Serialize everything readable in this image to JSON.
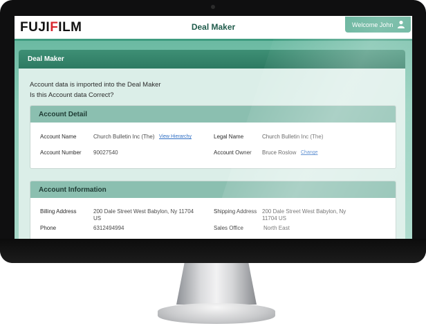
{
  "header": {
    "logo_text_left": "FUJI",
    "logo_text_accent": "F",
    "logo_text_right": "ILM",
    "app_title": "Deal Maker",
    "welcome_text": "Welcome John"
  },
  "panel": {
    "title": "Deal Maker",
    "intro_line1": "Account data is imported into the Deal Maker",
    "intro_line2": "Is this Account data Correct?"
  },
  "account_detail": {
    "title": "Account Detail",
    "account_name_label": "Account Name",
    "account_name_value": "Church Bulletin Inc (The)",
    "view_hierarchy_link": "View Hierarchy",
    "legal_name_label": "Legal Name",
    "legal_name_value": "Church Bulletin Inc (The)",
    "account_number_label": "Account Number",
    "account_number_value": "90027540",
    "account_owner_label": "Account Owner",
    "account_owner_value": "Bruce Roslow",
    "change_link": "Change"
  },
  "account_information": {
    "title": "Account Information",
    "billing_address_label": "Billing Address",
    "billing_address_line1": "200 Dale Street West Babylon, Ny 11704",
    "billing_address_line2": "US",
    "shipping_address_label": "Shipping Address",
    "shipping_address_line1": "200 Dale Street West Babylon, Ny",
    "shipping_address_line2": "11704 US",
    "phone_label": "Phone",
    "phone_value": "6312494994",
    "sales_office_label": "Sales Office",
    "sales_office_value": "North East"
  },
  "colors": {
    "brand_red": "#d8262e",
    "header_green": "#2d7a62",
    "card_header": "#8bbfb0",
    "link_blue": "#2f6fc4"
  }
}
